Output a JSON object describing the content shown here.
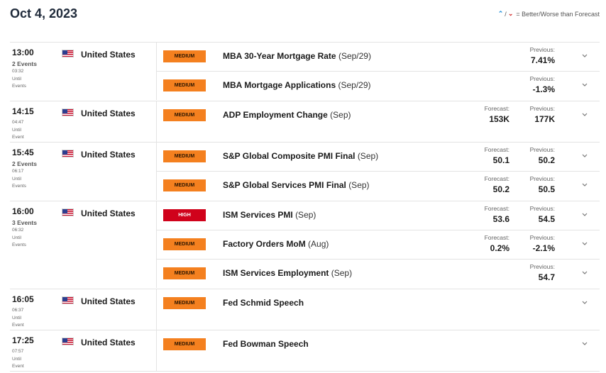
{
  "header": {
    "date": "Oct 4, 2023",
    "legend_up": "⌃",
    "legend_slash": "/",
    "legend_down": "⌄",
    "legend_text": "= Better/Worse than Forecast"
  },
  "labels": {
    "forecast": "Forecast:",
    "previous": "Previous:"
  },
  "groups": [
    {
      "time": "13:00",
      "events_count": "2 Events",
      "countdown": "03:32",
      "until1": "Until",
      "until2": "Events",
      "country": "United States",
      "events": [
        {
          "impact": "MEDIUM",
          "name": "MBA 30-Year Mortgage Rate",
          "period": "(Sep/29)",
          "forecast": "",
          "previous": "7.41%"
        },
        {
          "impact": "MEDIUM",
          "name": "MBA Mortgage Applications",
          "period": "(Sep/29)",
          "forecast": "",
          "previous": "-1.3%"
        }
      ]
    },
    {
      "time": "14:15",
      "events_count": "",
      "countdown": "04:47",
      "until1": "Until",
      "until2": "Event",
      "country": "United States",
      "events": [
        {
          "impact": "MEDIUM",
          "name": "ADP Employment Change",
          "period": "(Sep)",
          "forecast": "153K",
          "previous": "177K"
        }
      ]
    },
    {
      "time": "15:45",
      "events_count": "2 Events",
      "countdown": "06:17",
      "until1": "Until",
      "until2": "Events",
      "country": "United States",
      "events": [
        {
          "impact": "MEDIUM",
          "name": "S&P Global Composite PMI Final",
          "period": "(Sep)",
          "forecast": "50.1",
          "previous": "50.2"
        },
        {
          "impact": "MEDIUM",
          "name": "S&P Global Services PMI Final",
          "period": "(Sep)",
          "forecast": "50.2",
          "previous": "50.5"
        }
      ]
    },
    {
      "time": "16:00",
      "events_count": "3 Events",
      "countdown": "06:32",
      "until1": "Until",
      "until2": "Events",
      "country": "United States",
      "events": [
        {
          "impact": "HIGH",
          "name": "ISM Services PMI",
          "period": "(Sep)",
          "forecast": "53.6",
          "previous": "54.5"
        },
        {
          "impact": "MEDIUM",
          "name": "Factory Orders MoM",
          "period": "(Aug)",
          "forecast": "0.2%",
          "previous": "-2.1%"
        },
        {
          "impact": "MEDIUM",
          "name": "ISM Services Employment",
          "period": "(Sep)",
          "forecast": "",
          "previous": "54.7"
        }
      ]
    },
    {
      "time": "16:05",
      "events_count": "",
      "countdown": "06:37",
      "until1": "Until",
      "until2": "Event",
      "country": "United States",
      "events": [
        {
          "impact": "MEDIUM",
          "name": "Fed Schmid Speech",
          "period": "",
          "forecast": "",
          "previous": ""
        }
      ]
    },
    {
      "time": "17:25",
      "events_count": "",
      "countdown": "07:57",
      "until1": "Until",
      "until2": "Event",
      "country": "United States",
      "events": [
        {
          "impact": "MEDIUM",
          "name": "Fed Bowman Speech",
          "period": "",
          "forecast": "",
          "previous": ""
        }
      ]
    }
  ],
  "colors": {
    "medium": "#f4801f",
    "high": "#d0021b",
    "better": "#1a8cd8",
    "worse": "#d32f2f"
  },
  "icons": {
    "flag": "us-flag-icon",
    "expand": "chevron-down-icon"
  }
}
